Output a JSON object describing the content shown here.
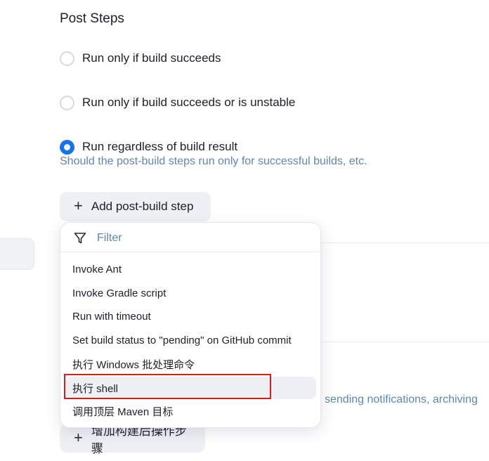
{
  "post_steps": {
    "title": "Post Steps",
    "options": [
      {
        "label": "Run only if build succeeds",
        "checked": false
      },
      {
        "label": "Run only if build succeeds or is unstable",
        "checked": false
      },
      {
        "label": "Run regardless of build result",
        "checked": true
      }
    ],
    "help": "Should the post-build steps run only for successful builds, etc."
  },
  "add_post_build_step": {
    "icon": "plus-icon",
    "label": "Add post-build step"
  },
  "dropdown": {
    "filter_placeholder": "Filter",
    "filter_icon": "filter-icon",
    "items": [
      {
        "label": "Invoke Ant"
      },
      {
        "label": "Invoke Gradle script"
      },
      {
        "label": "Run with timeout"
      },
      {
        "label": "Set build status to \"pending\" on GitHub commit"
      },
      {
        "label": "执行 Windows 批处理命令"
      },
      {
        "label": "执行 shell",
        "hovered": true,
        "annotated": true
      },
      {
        "label": "调用顶层 Maven 目标"
      }
    ]
  },
  "post_build_actions": {
    "help_fragment": "sending notifications, archiving",
    "add_button": {
      "icon": "plus-icon",
      "label": "增加构建后操作步骤"
    }
  },
  "colors": {
    "accent": "#1572ea",
    "help_text": "#5e86b2",
    "annotation": "#e01919"
  }
}
